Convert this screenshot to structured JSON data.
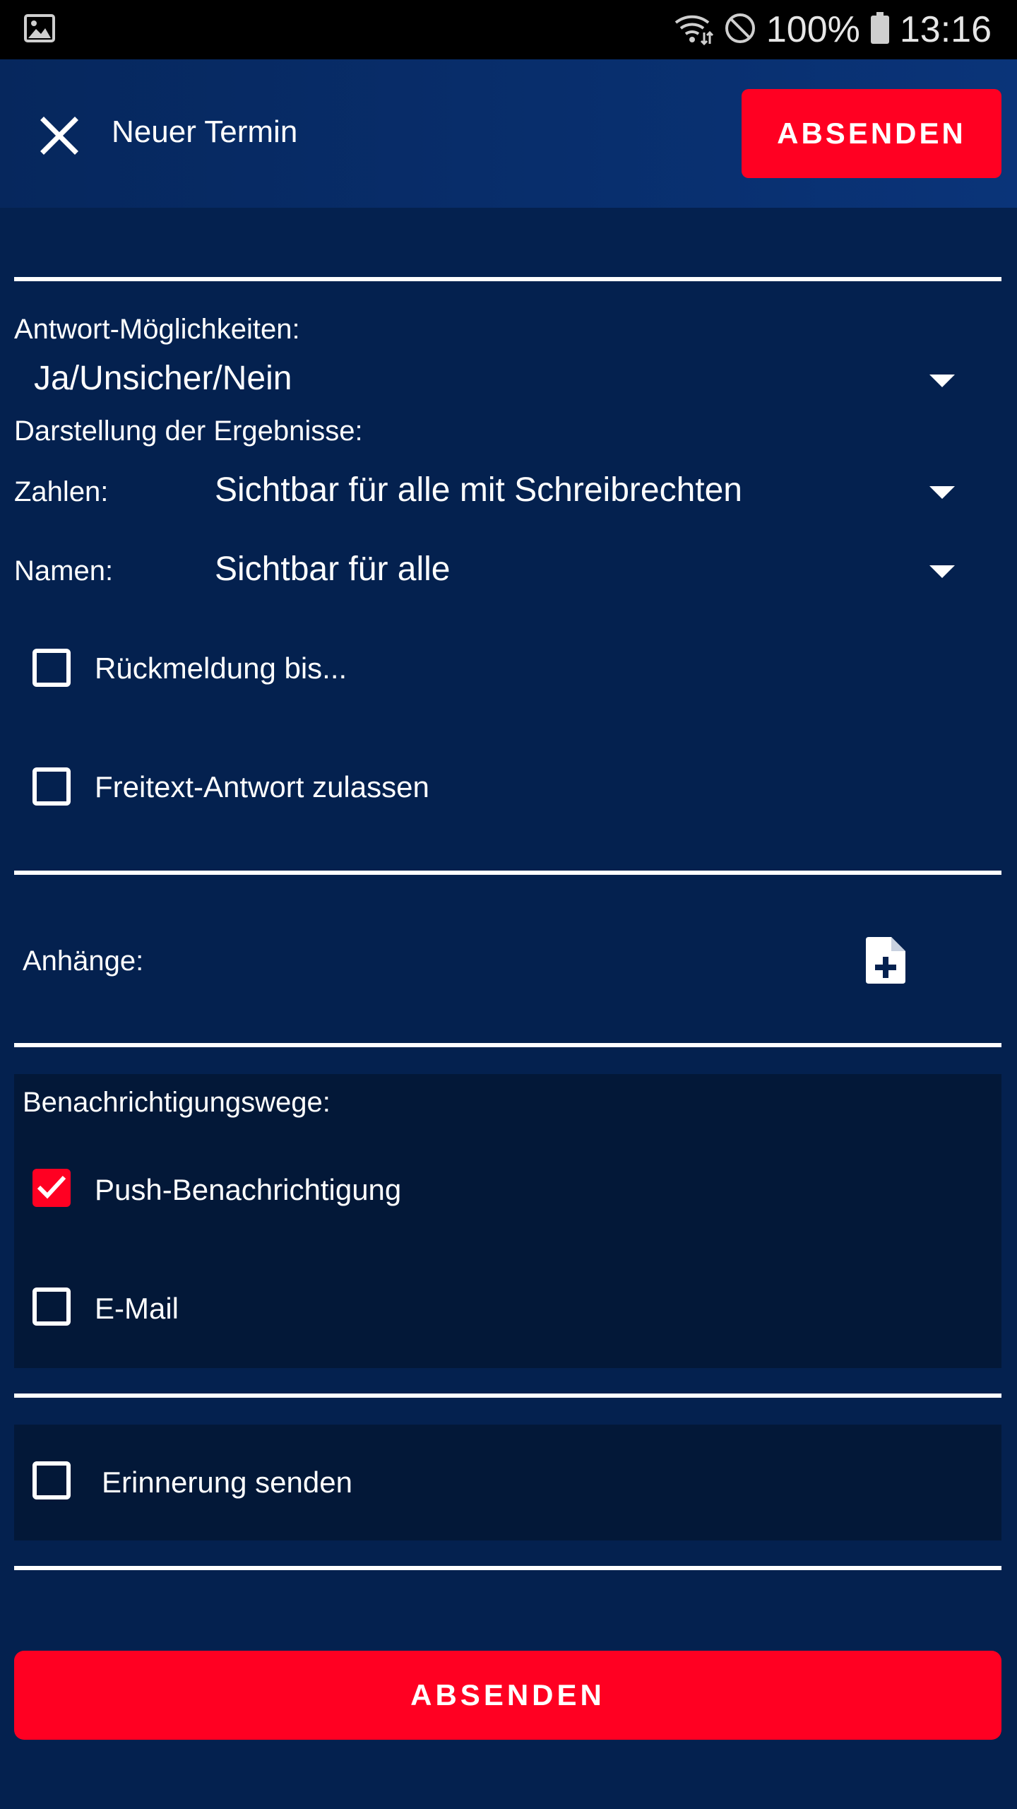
{
  "status_bar": {
    "gallery_icon": "image-icon",
    "wifi_icon": "wifi-icon",
    "dnd_icon": "do-not-disturb-icon",
    "battery_percent": "100%",
    "battery_icon": "battery-icon",
    "time": "13:16"
  },
  "header": {
    "close_icon": "close-icon",
    "title": "Neuer Termin",
    "send_label": "ABSENDEN"
  },
  "answers": {
    "label": "Antwort-Möglichkeiten:",
    "selected": "Ja/Unsicher/Nein"
  },
  "results": {
    "heading": "Darstellung der Ergebnisse:",
    "numbers_label": "Zahlen:",
    "numbers_selected": "Sichtbar für alle mit Schreibrechten",
    "names_label": "Namen:",
    "names_selected": "Sichtbar für alle"
  },
  "options": {
    "deadline_label": "Rückmeldung bis...",
    "deadline_checked": false,
    "freetext_label": "Freitext-Antwort zulassen",
    "freetext_checked": false
  },
  "attachments": {
    "label": "Anhänge:",
    "add_icon": "add-file-icon"
  },
  "notifications": {
    "heading": "Benachrichtigungswege:",
    "push_label": "Push-Benachrichtigung",
    "push_checked": true,
    "email_label": "E-Mail",
    "email_checked": false
  },
  "reminder": {
    "label": "Erinnerung senden",
    "checked": false
  },
  "footer": {
    "send_label": "ABSENDEN"
  },
  "colors": {
    "background": "#04214f",
    "app_bar": "#0a3479",
    "accent": "#ff0022",
    "panel": "#031838"
  }
}
